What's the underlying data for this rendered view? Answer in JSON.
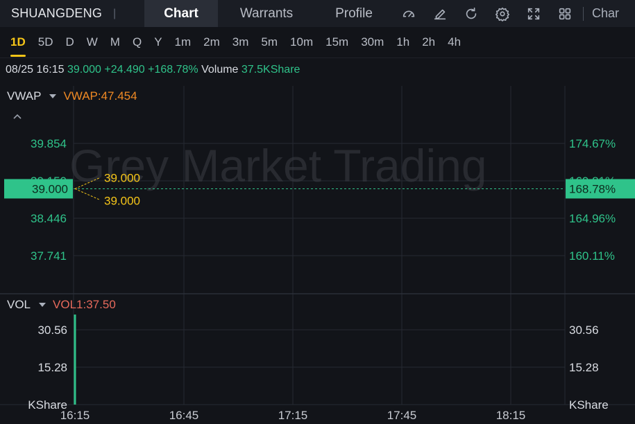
{
  "header": {
    "ticker": "SHUANGDENG",
    "tabs": [
      "Chart",
      "Warrants",
      "Profile"
    ],
    "active_tab": "Chart",
    "tools": [
      "gauge-icon",
      "pencil-icon",
      "refresh-icon",
      "gear-icon",
      "fullscreen-icon",
      "grid-icon"
    ],
    "overflow_label": "Char"
  },
  "intervals": [
    "1D",
    "5D",
    "D",
    "W",
    "M",
    "Q",
    "Y",
    "1m",
    "2m",
    "3m",
    "5m",
    "10m",
    "15m",
    "30m",
    "1h",
    "2h",
    "4h"
  ],
  "active_interval": "1D",
  "quote": {
    "datetime": "08/25 16:15",
    "price": "39.000",
    "change": "+24.490",
    "change_pct": "+168.78%",
    "volume_label": "Volume",
    "volume_value": "37.5KShare"
  },
  "indicators": {
    "main_name": "VWAP",
    "main_value": "VWAP:47.454",
    "sub_name": "VOL",
    "sub_value": "VOL1:37.50"
  },
  "watermark": "Grey Market Trading",
  "colors": {
    "up": "#2fc38a",
    "accent": "#f5c518",
    "vwap": "#f08a24",
    "vol": "#e76a5c"
  },
  "chart_data": {
    "type": "line",
    "price_axis_left": [
      "39.854",
      "39.150",
      "38.446",
      "37.741"
    ],
    "price_axis_right": [
      "174.67%",
      "169.81%",
      "164.96%",
      "160.11%"
    ],
    "current_price_tag": "39.000",
    "current_pct_tag": "168.78%",
    "annotations": [
      "39.000",
      "39.000"
    ],
    "volume_axis": [
      "30.56",
      "15.28",
      "KShare"
    ],
    "volume_axis_right": [
      "30.56",
      "15.28",
      "KShare"
    ],
    "x_ticks": [
      "16:15",
      "16:45",
      "17:15",
      "17:45",
      "18:15"
    ],
    "points": [
      {
        "x": "16:15",
        "price": 39.0,
        "volume": 37.5
      }
    ],
    "ylim": [
      37.741,
      39.854
    ],
    "volume_ylim": [
      0,
      37.5
    ]
  }
}
